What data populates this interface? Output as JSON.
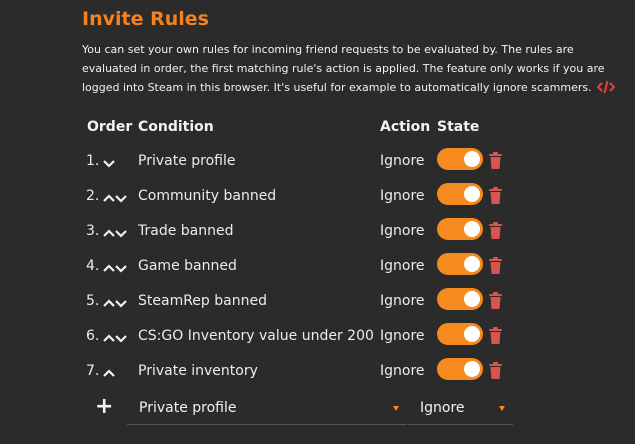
{
  "title": "Invite Rules",
  "description": "You can set your own rules for incoming friend requests to be evaluated by. The rules are evaluated in order, the first matching rule's action is applied. The feature only works if you are logged into Steam in this browser. It's useful for example to automatically ignore scammers.",
  "headers": {
    "order": "Order",
    "condition": "Condition",
    "action": "Action",
    "state": "State"
  },
  "rules": [
    {
      "order": "1.",
      "condition": "Private profile",
      "action": "Ignore",
      "up": false,
      "down": true,
      "enabled": true
    },
    {
      "order": "2.",
      "condition": "Community banned",
      "action": "Ignore",
      "up": true,
      "down": true,
      "enabled": true
    },
    {
      "order": "3.",
      "condition": "Trade banned",
      "action": "Ignore",
      "up": true,
      "down": true,
      "enabled": true
    },
    {
      "order": "4.",
      "condition": "Game banned",
      "action": "Ignore",
      "up": true,
      "down": true,
      "enabled": true
    },
    {
      "order": "5.",
      "condition": "SteamRep banned",
      "action": "Ignore",
      "up": true,
      "down": true,
      "enabled": true
    },
    {
      "order": "6.",
      "condition": "CS:GO Inventory value under 200",
      "action": "Ignore",
      "up": true,
      "down": true,
      "enabled": true
    },
    {
      "order": "7.",
      "condition": "Private inventory",
      "action": "Ignore",
      "up": true,
      "down": false,
      "enabled": true
    }
  ],
  "new_rule": {
    "plus": "+",
    "condition_selected": "Private profile",
    "action_selected": "Ignore"
  },
  "colors": {
    "accent": "#f58a1f",
    "title": "#f3821f",
    "trash": "#d9534f",
    "code_icon": "#e2443b",
    "background": "#2b2b2b"
  }
}
